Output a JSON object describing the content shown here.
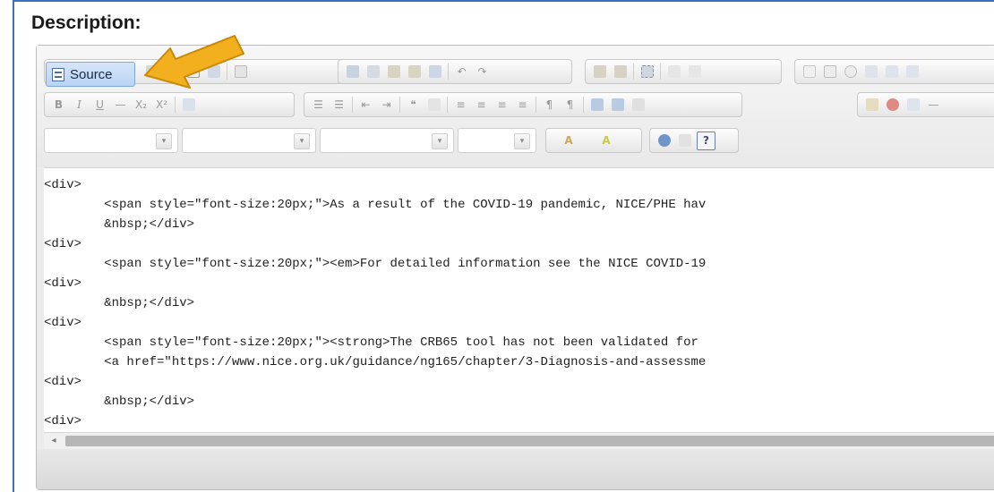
{
  "section": {
    "title": "Description:"
  },
  "toolbar": {
    "source_label": "Source",
    "row2_buttons": [
      "B",
      "I",
      "U",
      "—",
      "X₂",
      "X²"
    ],
    "combo_arrow": "▾",
    "text_color_label": "A",
    "bg_color_label": "A",
    "help_label": "?"
  },
  "editor": {
    "code_lines": [
      "<div>",
      "        <span style=\"font-size:20px;\">As a result of the COVID-19 pandemic, NICE/PHE hav",
      "        &nbsp;</div>",
      "<div>",
      "        <span style=\"font-size:20px;\"><em>For detailed information see the NICE COVID-19",
      "<div>",
      "        &nbsp;</div>",
      "<div>",
      "        <span style=\"font-size:20px;\"><strong>The CRB65 tool has not been validated for",
      "        <a href=\"https://www.nice.org.uk/guidance/ng165/chapter/3-Diagnosis-and-assessme",
      "<div>",
      "        &nbsp;</div>",
      "<div>"
    ],
    "scroll_left_glyph": "◂"
  },
  "colors": {
    "accent_border": "#3c6ec2",
    "arrow_fill": "#f2b01e",
    "arrow_stroke": "#c98a0a",
    "source_button": "#c6dcf7"
  }
}
